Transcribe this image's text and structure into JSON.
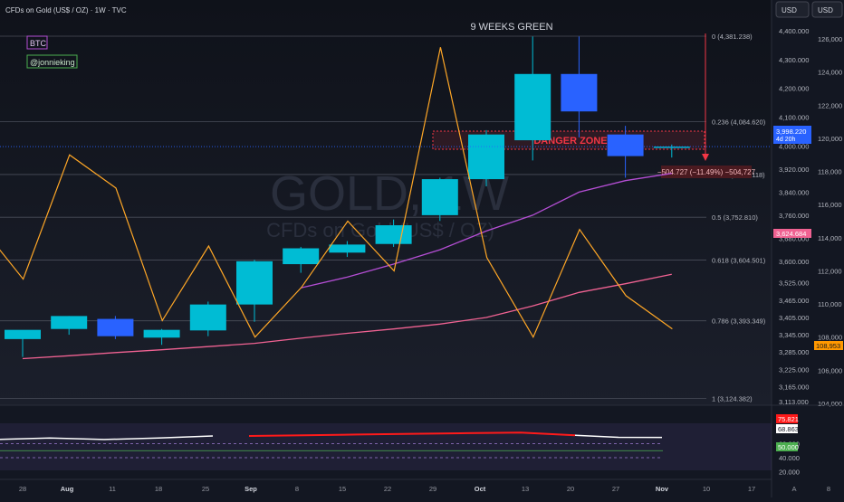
{
  "header": {
    "symbol_line": "CFDs on Gold (US$ / OZ) · 1W · TVC",
    "currency_button_1": "USD",
    "currency_button_2": "USD"
  },
  "labels": {
    "btc": "BTC",
    "author": "@jonnieking",
    "weeks_green": "9 WEEKS GREEN",
    "danger_zone": "DANGER ZONE",
    "measure": "−504.727 (−11.49%) −504,727",
    "watermark_symbol": "GOLD, 1W",
    "watermark_desc": "CFDs on Gold (US$ / OZ)",
    "price_tag_value": "3,998.220",
    "price_tag_countdown": "4d 20h",
    "pink_line_tag": "3,624.684",
    "orange_line_tag": "108,953",
    "osc_red_tag": "75.821",
    "osc_white_tag": "68.863",
    "osc_green_tag": "50.000"
  },
  "colors": {
    "background": "#131722",
    "bull_candle": "#00bcd4",
    "bear_candle": "#2962ff",
    "ma_purple": "#b44ed4",
    "ma_pink": "#f06292",
    "btc_line": "#ffa726",
    "danger": "#f23645",
    "osc_red": "#ff1a1a",
    "osc_white": "#ffffff",
    "osc_green": "#4caf50"
  },
  "chart_data": {
    "type": "candlestick",
    "x_ticks": [
      "28",
      "Aug",
      "11",
      "18",
      "25",
      "Sep",
      "8",
      "15",
      "22",
      "29",
      "Oct",
      "13",
      "20",
      "27",
      "Nov",
      "10",
      "17",
      "A",
      "8"
    ],
    "candles": [
      {
        "o": 3330,
        "h": 3345,
        "l": 3268,
        "c": 3362
      },
      {
        "o": 3365,
        "h": 3410,
        "l": 3345,
        "c": 3410
      },
      {
        "o": 3400,
        "h": 3410,
        "l": 3330,
        "c": 3340
      },
      {
        "o": 3335,
        "h": 3365,
        "l": 3310,
        "c": 3362
      },
      {
        "o": 3360,
        "h": 3460,
        "l": 3340,
        "c": 3450
      },
      {
        "o": 3450,
        "h": 3605,
        "l": 3390,
        "c": 3600
      },
      {
        "o": 3590,
        "h": 3650,
        "l": 3560,
        "c": 3645
      },
      {
        "o": 3630,
        "h": 3670,
        "l": 3615,
        "c": 3658
      },
      {
        "o": 3660,
        "h": 3745,
        "l": 3650,
        "c": 3725
      },
      {
        "o": 3760,
        "h": 3890,
        "l": 3740,
        "c": 3885
      },
      {
        "o": 3885,
        "h": 4055,
        "l": 3860,
        "c": 4040
      },
      {
        "o": 4020,
        "h": 4380,
        "l": 3950,
        "c": 4250
      },
      {
        "o": 4250,
        "h": 4380,
        "l": 4030,
        "c": 4120
      },
      {
        "o": 4040,
        "h": 4070,
        "l": 3890,
        "c": 3965
      },
      {
        "o": 3998,
        "h": 4005,
        "l": 3960,
        "c": 3998
      }
    ],
    "ma_fast": [
      null,
      null,
      null,
      null,
      null,
      null,
      3508,
      3545,
      3590,
      3640,
      3705,
      3760,
      3840,
      3880,
      3905
    ],
    "ma_slow": [
      3262,
      3272,
      3283,
      3293,
      3304,
      3315,
      3333,
      3350,
      3365,
      3382,
      3405,
      3445,
      3492,
      3522,
      3555
    ],
    "btc_line": [
      115000,
      111500,
      119000,
      117000,
      109000,
      113500,
      108000,
      111000,
      115000,
      112000,
      125500,
      112800,
      108000,
      114500,
      110500,
      108500
    ],
    "y_axis_ticks": [
      4400,
      4300,
      4200,
      4100,
      4000,
      3920,
      3840,
      3760,
      3680,
      3600,
      3525,
      3465,
      3405,
      3345,
      3285,
      3225,
      3165,
      3113
    ],
    "y_axis_ticks_btc": [
      126000,
      124000,
      122000,
      120000,
      118000,
      116000,
      114000,
      112000,
      110000,
      108000,
      106000,
      104000
    ],
    "fib_levels": [
      {
        "price": 4381.238,
        "label": "0 (4,381.238)"
      },
      {
        "price": 4084.62,
        "label": "0.236 (4,084.620)"
      },
      {
        "price": 3901.118,
        "label": "0.382 (3,901.118)"
      },
      {
        "price": 3752.81,
        "label": "0.5 (3,752.810)"
      },
      {
        "price": 3604.501,
        "label": "0.618 (3,604.501)"
      },
      {
        "price": 3393.349,
        "label": "0.786 (3,393.349)"
      },
      {
        "price": 3124.382,
        "label": "1 (3,124.382)"
      }
    ],
    "oscillator": {
      "levels": [
        60,
        50,
        40
      ],
      "axis_ticks": [
        60,
        40,
        20
      ],
      "red_segment": [
        71,
        72,
        73,
        74,
        75,
        75.8,
        72
      ],
      "white_left": [
        66,
        68,
        66,
        68,
        71
      ],
      "white_right": [
        72,
        69,
        68.9
      ]
    }
  }
}
